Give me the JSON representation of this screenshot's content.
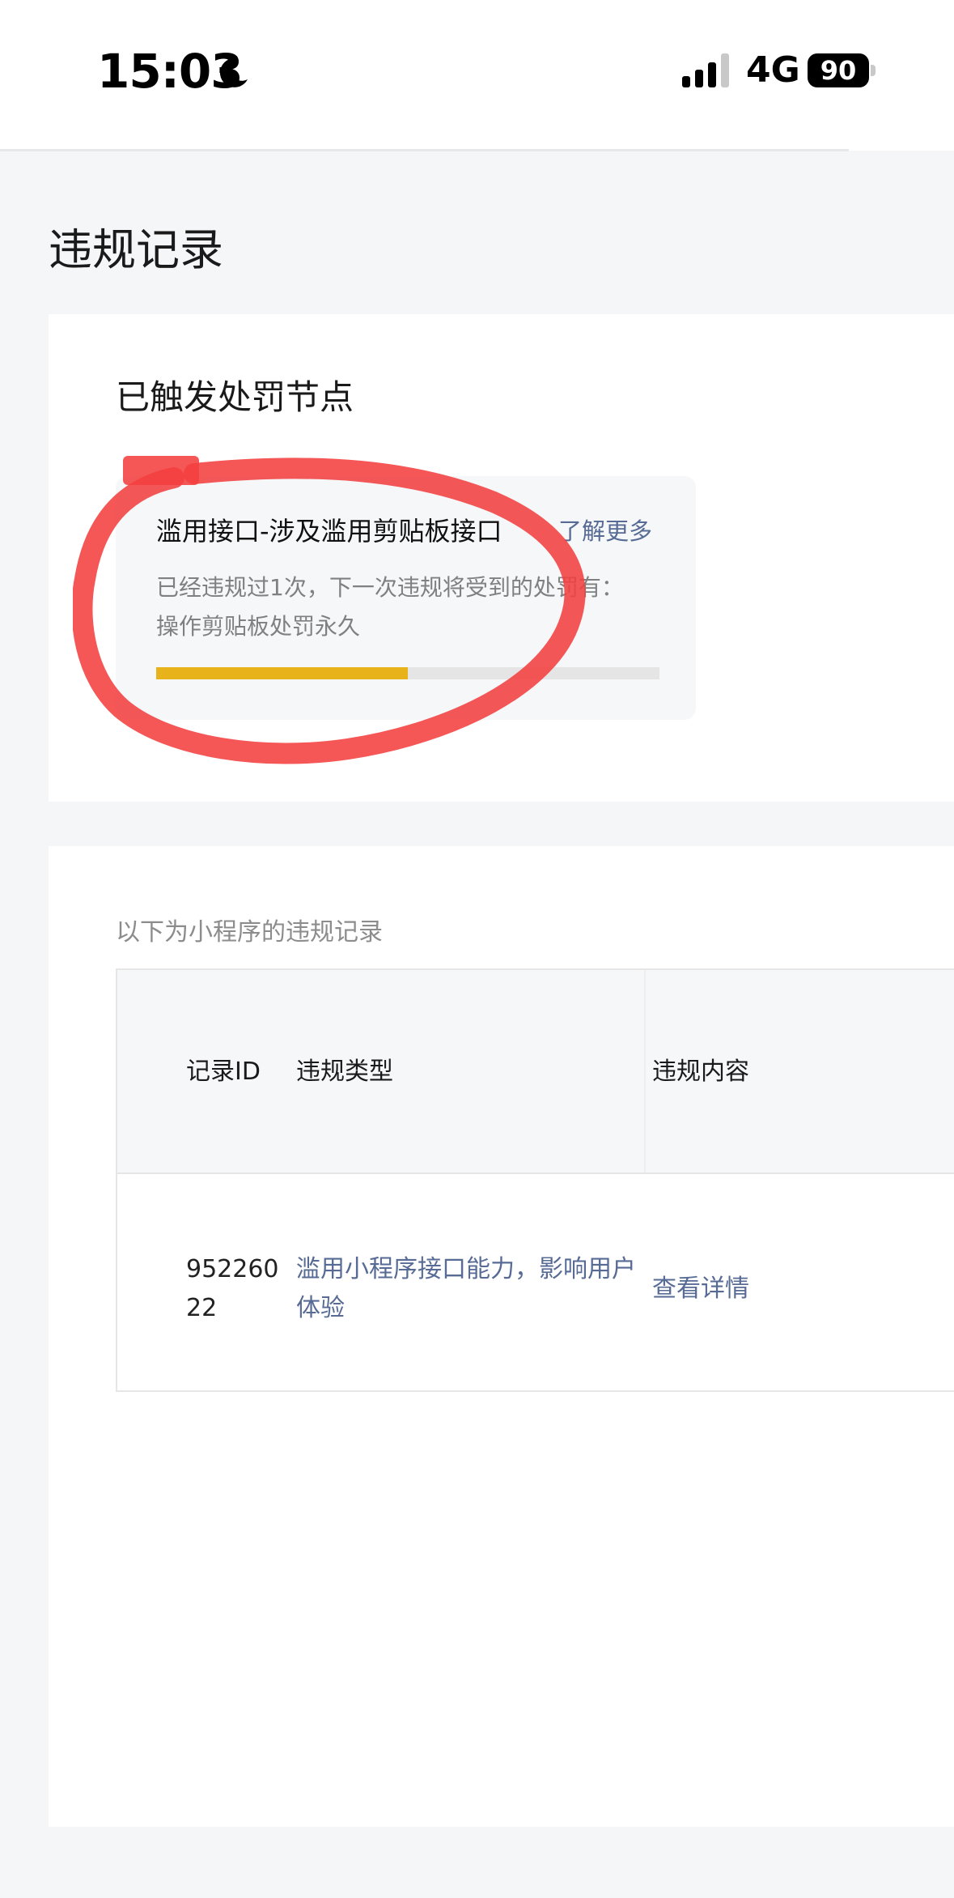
{
  "status_bar": {
    "time": "15:03",
    "network": "4G",
    "battery": "90"
  },
  "page": {
    "title": "违规记录"
  },
  "penalty": {
    "section_title": "已触发处罚节点",
    "node_title": "滥用接口-涉及滥用剪贴板接口",
    "learn_more": "了解更多",
    "desc_line1": "已经违规过1次，下一次违规将受到的处罚有：",
    "desc_line2": "操作剪贴板处罚永久",
    "progress_fraction": 0.5,
    "progress_color": "#e8b21a",
    "annotation_color": "#f2403f"
  },
  "records": {
    "caption": "以下为小程序的违规记录",
    "columns": [
      "记录ID",
      "违规类型",
      "违规内容"
    ],
    "rows": [
      {
        "id": "95226022",
        "type": "滥用小程序接口能力，影响用户体验",
        "content": "查看详情"
      }
    ]
  },
  "colors": {
    "link": "#576b95",
    "background": "#f5f6f8"
  }
}
